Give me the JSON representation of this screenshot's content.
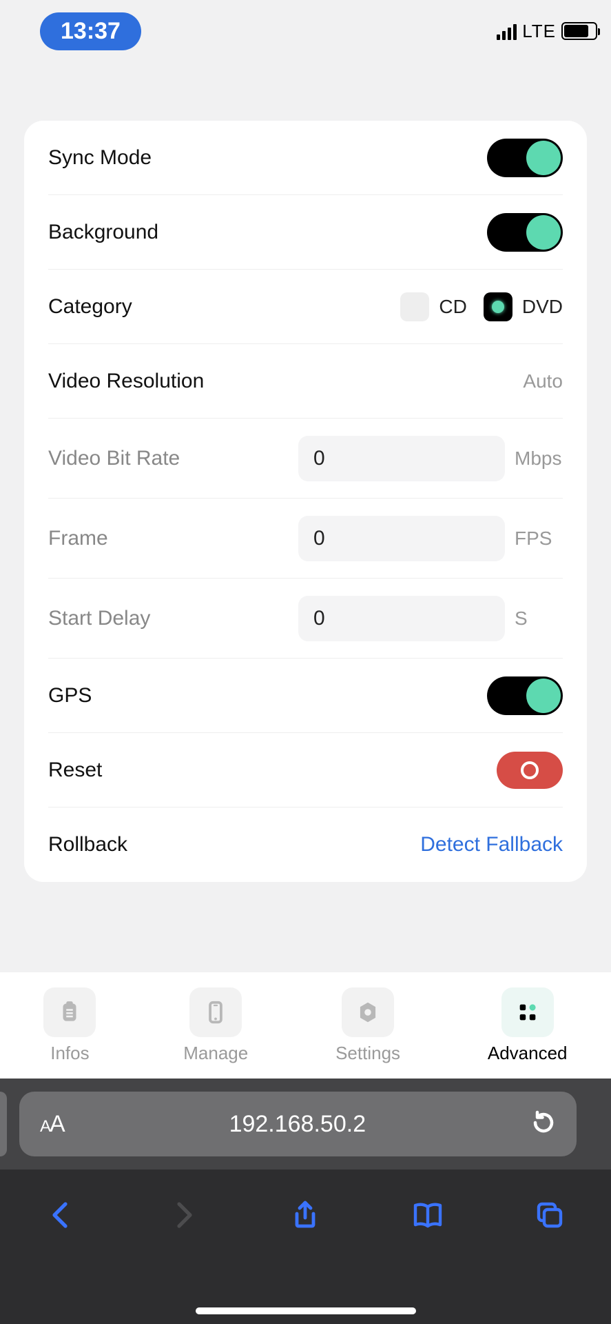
{
  "status": {
    "time": "13:37",
    "network": "LTE"
  },
  "settings": {
    "syncMode": {
      "label": "Sync Mode",
      "value": true
    },
    "background": {
      "label": "Background",
      "value": true
    },
    "category": {
      "label": "Category",
      "options": [
        {
          "label": "CD",
          "selected": false
        },
        {
          "label": "DVD",
          "selected": true
        }
      ]
    },
    "videoResolution": {
      "label": "Video Resolution",
      "value": "Auto"
    },
    "videoBitRate": {
      "label": "Video Bit Rate",
      "value": "0",
      "unit": "Mbps"
    },
    "frame": {
      "label": "Frame",
      "value": "0",
      "unit": "FPS"
    },
    "startDelay": {
      "label": "Start Delay",
      "value": "0",
      "unit": "S"
    },
    "gps": {
      "label": "GPS",
      "value": true
    },
    "reset": {
      "label": "Reset"
    },
    "rollback": {
      "label": "Rollback",
      "action": "Detect Fallback"
    }
  },
  "nav": {
    "items": [
      {
        "label": "Infos",
        "icon": "clipboard-icon",
        "active": false
      },
      {
        "label": "Manage",
        "icon": "phone-icon",
        "active": false
      },
      {
        "label": "Settings",
        "icon": "gear-icon",
        "active": false
      },
      {
        "label": "Advanced",
        "icon": "grid-icon",
        "active": true
      }
    ]
  },
  "browser": {
    "url": "192.168.50.2"
  }
}
